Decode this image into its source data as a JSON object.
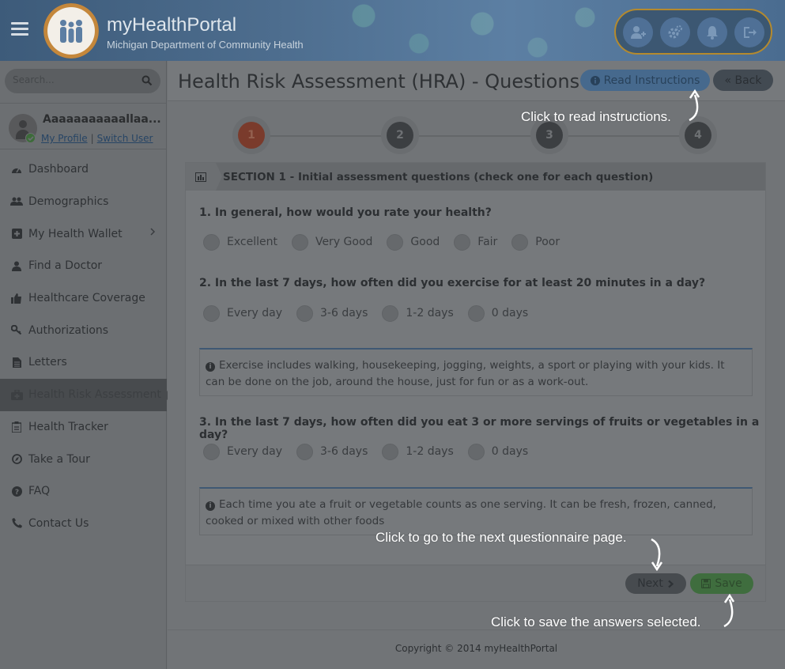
{
  "header": {
    "brand_title": "myHealthPortal",
    "brand_subtitle": "Michigan Department of Community Health",
    "icons": [
      "add-user-icon",
      "settings-icon",
      "bell-icon",
      "sign-out-icon"
    ],
    "colors": {
      "header_bg": "#4d6d8e",
      "icon_group_border": "#b48a2e"
    }
  },
  "sidebar": {
    "search_placeholder": "Search...",
    "profile": {
      "name": "Aaaaaaaaaaallaa...",
      "my_profile": "My Profile",
      "separator": "|",
      "switch_user": "Switch User"
    },
    "items": [
      {
        "label": "Dashboard",
        "icon": "dashboard-icon"
      },
      {
        "label": "Demographics",
        "icon": "users-icon"
      },
      {
        "label": "My Health Wallet",
        "icon": "plus-square-icon",
        "has_submenu": true
      },
      {
        "label": "Find a Doctor",
        "icon": "user-md-icon"
      },
      {
        "label": "Healthcare Coverage",
        "icon": "thumbs-up-icon"
      },
      {
        "label": "Authorizations",
        "icon": "key-icon"
      },
      {
        "label": "Letters",
        "icon": "file-icon"
      },
      {
        "label": "Health Risk Assessment",
        "icon": "medkit-icon",
        "active": true
      },
      {
        "label": "Health Tracker",
        "icon": "clipboard-icon"
      },
      {
        "label": "Take a Tour",
        "icon": "compass-icon"
      },
      {
        "label": "FAQ",
        "icon": "question-icon"
      },
      {
        "label": "Contact Us",
        "icon": "phone-icon"
      }
    ]
  },
  "main": {
    "title": "Health Risk Assessment (HRA) - Questions",
    "read_instructions": "Read Instructions",
    "back": "« Back",
    "steps": [
      "1",
      "2",
      "3",
      "4"
    ],
    "active_step": 1,
    "section_title": "SECTION 1 - Initial assessment questions (check one for each question)",
    "questions": [
      {
        "text": "1. In general, how would you rate your health?",
        "options": [
          "Excellent",
          "Very Good",
          "Good",
          "Fair",
          "Poor"
        ]
      },
      {
        "text": "2. In the last 7 days, how often did you exercise for at least 20 minutes in a day?",
        "options": [
          "Every day",
          "3-6 days",
          "1-2 days",
          "0 days"
        ],
        "note": "Exercise includes walking, housekeeping, jogging, weights, a sport or playing with your kids. It can be done on the job, around the house, just for fun or as a work-out."
      },
      {
        "text": "3. In the last 7 days, how often did you eat 3 or more servings of fruits or vegetables in a day?",
        "options": [
          "Every day",
          "3-6 days",
          "1-2 days",
          "0 days"
        ],
        "note": "Each time you ate a fruit or vegetable counts as one serving. It can be fresh, frozen, canned, cooked or mixed with other foods"
      }
    ],
    "next": "Next",
    "save": "Save",
    "copyright": "Copyright © 2014 myHealthPortal"
  },
  "annotations": {
    "read_instructions": "Click to read instructions.",
    "next_page": "Click to go to the next questionnaire page.",
    "save": "Click to save the answers selected."
  }
}
